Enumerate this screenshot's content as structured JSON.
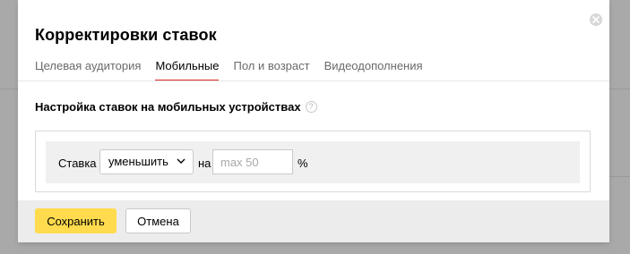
{
  "modal": {
    "title": "Корректировки ставок",
    "close_icon": "close-icon"
  },
  "tabs": [
    {
      "label": "Целевая аудитория",
      "active": false
    },
    {
      "label": "Мобильные",
      "active": true
    },
    {
      "label": "Пол и возраст",
      "active": false
    },
    {
      "label": "Видеодополнения",
      "active": false
    }
  ],
  "section": {
    "title": "Настройка ставок на мобильных устройствах",
    "help_icon": "question-circle-icon",
    "help_glyph": "?"
  },
  "bid_row": {
    "label": "Ставка",
    "mode_value": "уменьшить",
    "connector": "на",
    "amount_value": "",
    "amount_placeholder": "max 50",
    "unit": "%"
  },
  "footer": {
    "save_label": "Сохранить",
    "cancel_label": "Отмена"
  },
  "colors": {
    "accent_tab_underline": "#e02a2a",
    "save_button": "#ffdb4d",
    "overlay": "#a9a9a9"
  }
}
